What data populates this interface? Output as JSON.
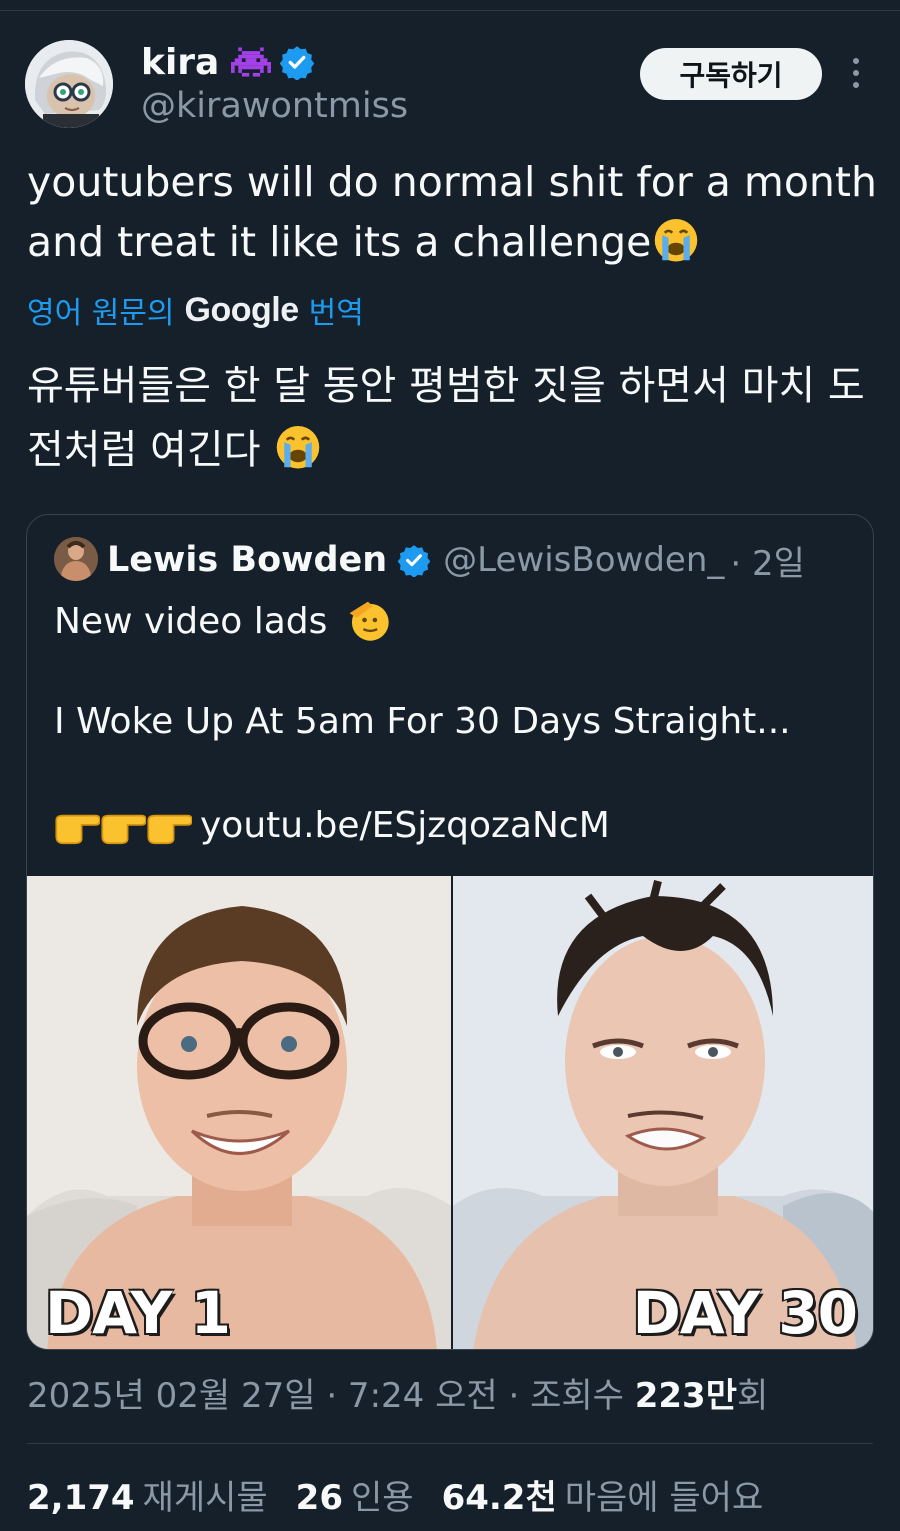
{
  "author": {
    "name": "kira",
    "handle": "@kirawontmiss",
    "badge_icons": [
      "alien-monster-icon",
      "verified-badge-icon"
    ],
    "subscribe_label": "구독하기"
  },
  "tweet": {
    "text": "youtubers will do normal shit for a month and treat it like its a challenge",
    "text_emoji": "loudly-crying-face-icon",
    "translate_prefix": "영어 원문의",
    "translate_brand": "Google",
    "translate_suffix": "번역",
    "translated_text": "유튜버들은 한 달 동안 평범한 짓을 하면서 마치 도전처럼 여긴다",
    "translated_emoji": "loudly-crying-face-icon"
  },
  "quote": {
    "name": "Lewis Bowden",
    "handle": "@LewisBowden_",
    "time": "· 2일",
    "line1": "New video lads",
    "line1_emoji": "saluting-face-icon",
    "line2": "I Woke Up At 5am For 30 Days Straight...",
    "link": "youtu.be/ESjzqozaNcM",
    "link_emoji": "pointing-right-hand-icon",
    "image_labels": [
      "DAY 1",
      "DAY 30"
    ]
  },
  "meta": {
    "date": "2025년 02월 27일 · 7:24 오전 · 조회수 ",
    "views": "223만",
    "views_suffix": "회"
  },
  "stats": [
    {
      "value": "2,174",
      "label": "재게시물"
    },
    {
      "value": "26",
      "label": "인용"
    },
    {
      "value": "64.2천",
      "label": "마음에 들어요"
    }
  ],
  "colors": {
    "background": "#15202b",
    "accent": "#1d9bf0",
    "muted": "#8b98a5"
  }
}
